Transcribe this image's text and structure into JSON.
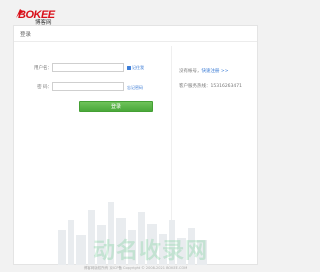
{
  "brand": {
    "name": "BOKEE",
    "subtitle": "博客网"
  },
  "panel": {
    "title": "登录"
  },
  "form": {
    "username_label": "用户名：",
    "password_label": "密 码：",
    "remember_label": "记住我",
    "forgot_label": "忘记密码",
    "login_button": "登录"
  },
  "side": {
    "register_prefix": "没有帐号，",
    "register_link": "快速注册 >>",
    "hotline": "客户服务热线：15316263471"
  },
  "watermark": "动名收录网",
  "footer": "博客网版权所有 京ICP备 Copyright © 2008-2021 BOKEE.COM",
  "colors": {
    "brand_red": "#d9101a",
    "button_green": "#4aa83a",
    "link_blue": "#3a7bd5"
  }
}
